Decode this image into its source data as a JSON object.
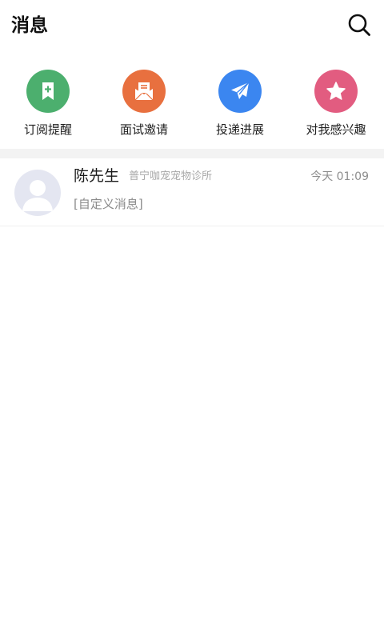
{
  "header": {
    "title": "消息",
    "search_icon": "search-icon"
  },
  "quick_actions": [
    {
      "label": "订阅提醒",
      "icon": "bookmark-plus-icon",
      "color": "#4caf6e"
    },
    {
      "label": "面试邀请",
      "icon": "mail-open-icon",
      "color": "#e8703f"
    },
    {
      "label": "投递进展",
      "icon": "paper-plane-icon",
      "color": "#3b86f0"
    },
    {
      "label": "对我感兴趣",
      "icon": "star-icon",
      "color": "#e25c80"
    }
  ],
  "messages": [
    {
      "name": "陈先生",
      "organization": "普宁咖宠宠物诊所",
      "time": "今天 01:09",
      "preview": "[自定义消息]",
      "avatar_icon": "default-avatar-icon"
    }
  ],
  "colors": {
    "divider": "#f3f3f3",
    "avatar_bg": "#e4e6f1"
  }
}
